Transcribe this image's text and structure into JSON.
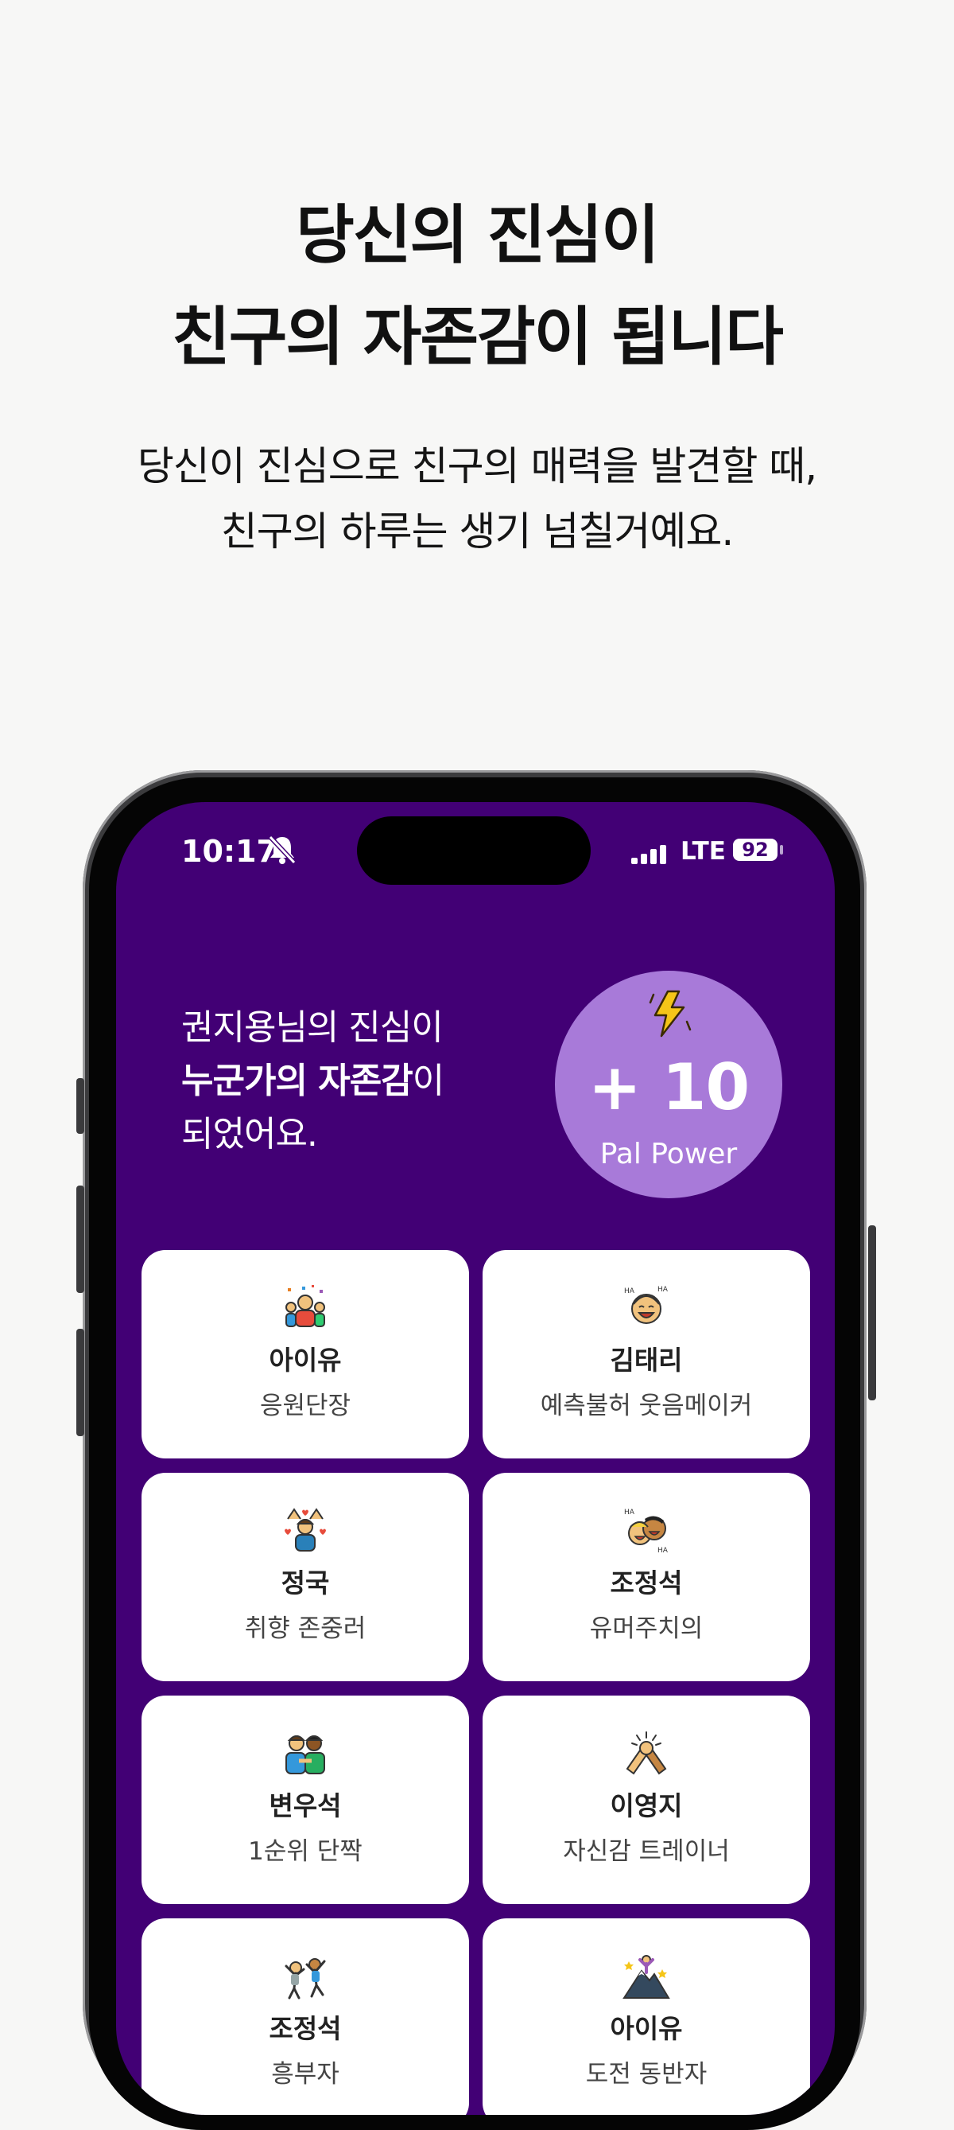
{
  "headline": {
    "line1": "당신의 진심이",
    "line2": "친구의 자존감이 됩니다"
  },
  "subline": {
    "line1": "당신이 진심으로 친구의 매력을 발견할 때,",
    "line2": "친구의 하루는 생기 넘칠거예요."
  },
  "status_bar": {
    "time": "10:17",
    "network": "LTE",
    "battery": "92"
  },
  "intro": {
    "line1": "권지용님의 진심이",
    "line2_bold": "누군가의 자존감",
    "line2_rest": "이",
    "line3": "되었어요."
  },
  "power": {
    "value": "+ 10",
    "label": "Pal Power"
  },
  "cards": [
    {
      "icon": "party-crowd-icon",
      "name": "아이유",
      "title": "응원단장"
    },
    {
      "icon": "laughing-face-icon",
      "name": "김태리",
      "title": "예측불허 웃음메이커"
    },
    {
      "icon": "person-hearts-icon",
      "name": "정국",
      "title": "취향 존중러"
    },
    {
      "icon": "two-laughing-faces-icon",
      "name": "조정석",
      "title": "유머주치의"
    },
    {
      "icon": "two-friends-icon",
      "name": "변우석",
      "title": "1순위 단짝"
    },
    {
      "icon": "handshake-icon",
      "name": "이영지",
      "title": "자신감 트레이너"
    },
    {
      "icon": "cheering-people-icon",
      "name": "조정석",
      "title": "흥부자"
    },
    {
      "icon": "mountain-summit-icon",
      "name": "아이유",
      "title": "도전 동반자"
    }
  ],
  "colors": {
    "screen_bg": "#420075",
    "power_circle": "#a87ad9",
    "page_bg": "#f7f7f6"
  }
}
